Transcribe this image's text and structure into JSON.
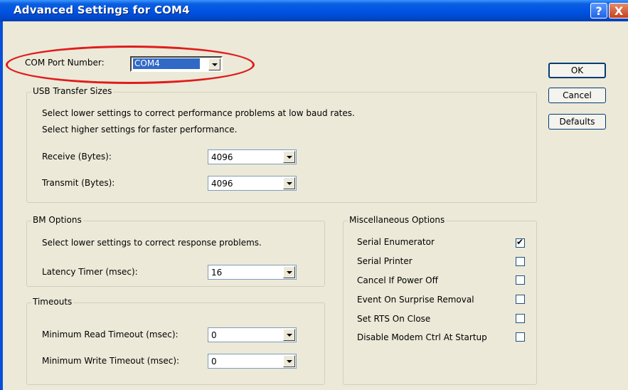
{
  "window": {
    "title": "Advanced Settings for COM4",
    "help_glyph": "?",
    "close_glyph": "X"
  },
  "com_port": {
    "label": "COM Port Number:",
    "value": "COM4"
  },
  "buttons": {
    "ok": "OK",
    "cancel": "Cancel",
    "defaults": "Defaults"
  },
  "usb": {
    "legend": "USB Transfer Sizes",
    "desc1": "Select lower settings to correct performance problems at low baud rates.",
    "desc2": "Select higher settings for faster performance.",
    "receive_label": "Receive (Bytes):",
    "receive_value": "4096",
    "transmit_label": "Transmit (Bytes):",
    "transmit_value": "4096"
  },
  "bm": {
    "legend": "BM Options",
    "desc": "Select lower settings to correct response problems.",
    "latency_label": "Latency Timer (msec):",
    "latency_value": "16"
  },
  "timeouts": {
    "legend": "Timeouts",
    "read_label": "Minimum Read Timeout (msec):",
    "read_value": "0",
    "write_label": "Minimum Write Timeout (msec):",
    "write_value": "0"
  },
  "misc": {
    "legend": "Miscellaneous Options",
    "options": [
      {
        "label": "Serial Enumerator",
        "checked": true
      },
      {
        "label": "Serial Printer",
        "checked": false
      },
      {
        "label": "Cancel If Power Off",
        "checked": false
      },
      {
        "label": "Event On Surprise Removal",
        "checked": false
      },
      {
        "label": "Set RTS On Close",
        "checked": false
      },
      {
        "label": "Disable Modem Ctrl At Startup",
        "checked": false
      }
    ]
  },
  "colors": {
    "highlight_oval": "#e01c1c",
    "titlebar": "#0054e3",
    "selection": "#316ac5"
  }
}
